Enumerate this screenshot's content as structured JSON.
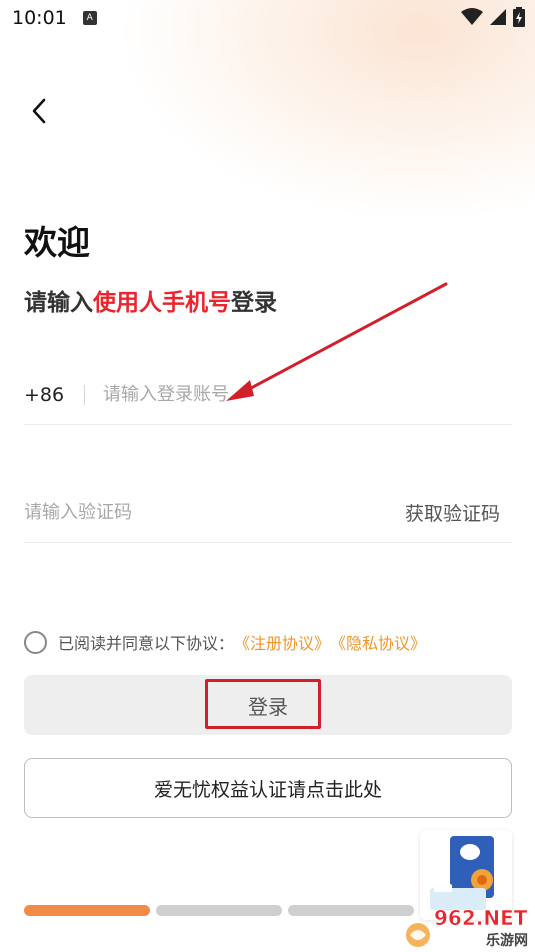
{
  "status_bar": {
    "time": "10:01",
    "notification_letter": "A"
  },
  "header": {
    "welcome": "欢迎",
    "subtitle_prefix": "请输入",
    "subtitle_highlight": "使用人手机号",
    "subtitle_suffix": "登录"
  },
  "phone": {
    "prefix": "+86",
    "placeholder": "请输入登录账号"
  },
  "code": {
    "placeholder": "请输入验证码",
    "get_code_label": "获取验证码"
  },
  "agreement": {
    "text": "已阅读并同意以下协议：",
    "register_link": "《注册协议》",
    "privacy_link": "《隐私协议》",
    "checked": false
  },
  "login_button": {
    "label": "登录"
  },
  "cert_button": {
    "label": "爱无忧权益认证请点击此处"
  },
  "tabs": [
    {
      "active": true
    },
    {
      "active": false
    },
    {
      "active": false
    }
  ],
  "watermark": {
    "line1": "962.NET",
    "line2": "乐游网"
  },
  "colors": {
    "highlight": "#e8262d",
    "link": "#f0962a",
    "active_tab": "#f28a4a",
    "annotation": "#d0202a"
  }
}
